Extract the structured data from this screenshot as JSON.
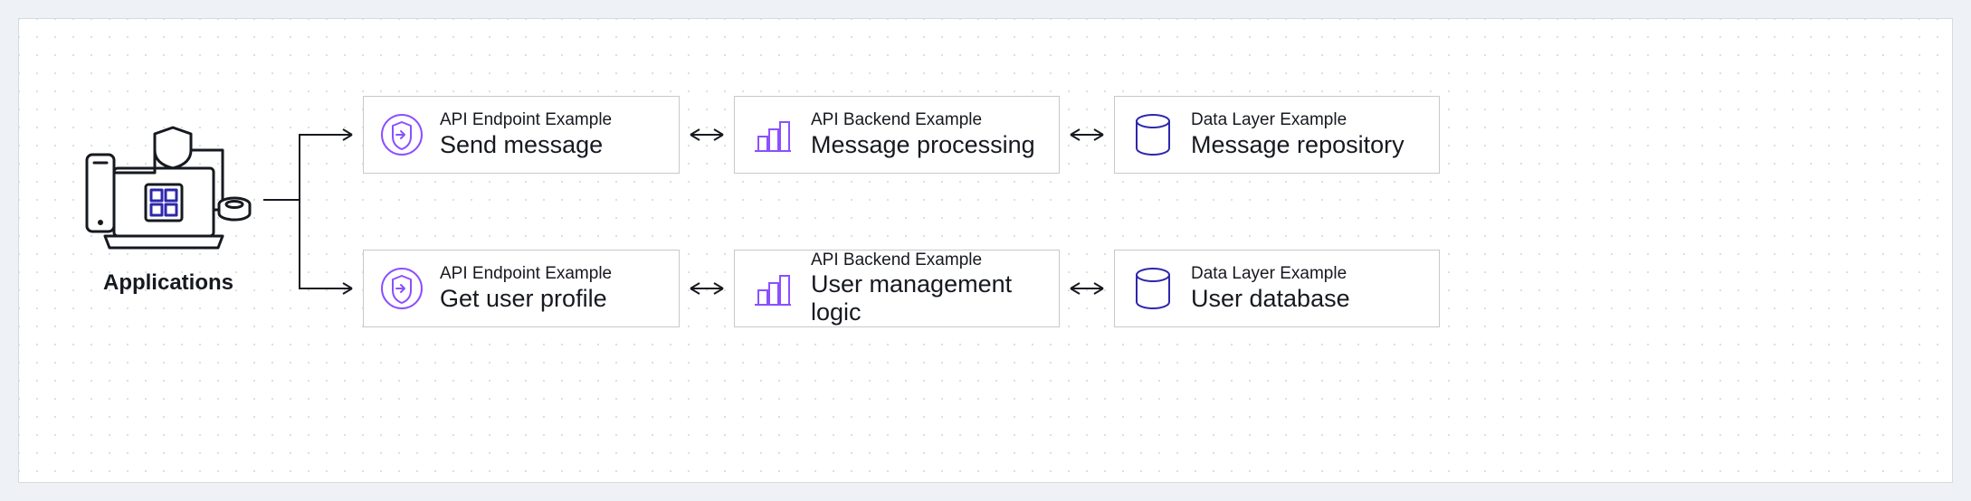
{
  "applications_label": "Applications",
  "rows": [
    {
      "endpoint": {
        "small": "API Endpoint Example",
        "big": "Send message"
      },
      "backend": {
        "small": "API Backend Example",
        "big": "Message processing"
      },
      "data": {
        "small": "Data Layer Example",
        "big": "Message repository"
      }
    },
    {
      "endpoint": {
        "small": "API Endpoint Example",
        "big": "Get user profile"
      },
      "backend": {
        "small": "API Backend Example",
        "big": "User management logic"
      },
      "data": {
        "small": "Data Layer Example",
        "big": "User database"
      }
    }
  ],
  "colors": {
    "endpoint_icon": "#8c4fff",
    "backend_icon": "#8c4fff",
    "data_icon": "#2e27ad"
  }
}
